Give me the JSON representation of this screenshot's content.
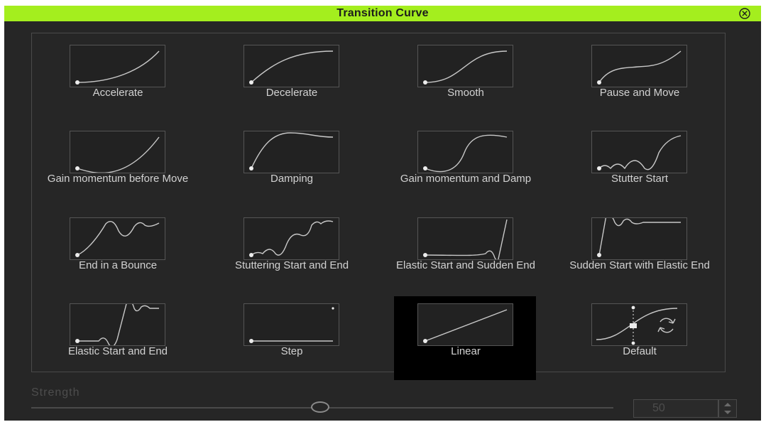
{
  "window": {
    "title": "Transition Curve"
  },
  "presets": [
    {
      "label": "Accelerate",
      "icon": "accelerate-curve-icon"
    },
    {
      "label": "Decelerate",
      "icon": "decelerate-curve-icon"
    },
    {
      "label": "Smooth",
      "icon": "smooth-curve-icon"
    },
    {
      "label": "Pause and Move",
      "icon": "pause-and-move-curve-icon"
    },
    {
      "label": "Gain momentum before Move",
      "icon": "gain-momentum-before-move-curve-icon"
    },
    {
      "label": "Damping",
      "icon": "damping-curve-icon"
    },
    {
      "label": "Gain momentum and Damp",
      "icon": "gain-momentum-and-damp-curve-icon"
    },
    {
      "label": "Stutter Start",
      "icon": "stutter-start-curve-icon"
    },
    {
      "label": "End in a Bounce",
      "icon": "end-in-a-bounce-curve-icon"
    },
    {
      "label": "Stuttering Start and End",
      "icon": "stuttering-start-and-end-curve-icon"
    },
    {
      "label": "Elastic Start and Sudden End",
      "icon": "elastic-start-sudden-end-curve-icon"
    },
    {
      "label": "Sudden Start with Elastic End",
      "icon": "sudden-start-elastic-end-curve-icon"
    },
    {
      "label": "Elastic Start and End",
      "icon": "elastic-start-and-end-curve-icon"
    },
    {
      "label": "Step",
      "icon": "step-curve-icon"
    },
    {
      "label": "Linear",
      "icon": "linear-curve-icon",
      "selected": true
    },
    {
      "label": "Default",
      "icon": "default-curve-icon"
    }
  ],
  "strength": {
    "label": "Strength",
    "value": "50",
    "enabled": false
  },
  "colors": {
    "titlebar": "#a4ee1e",
    "background": "#262626",
    "selected_tile": "#000000",
    "label_text": "#d2d2d2",
    "disabled_text": "#4d4d4d"
  }
}
